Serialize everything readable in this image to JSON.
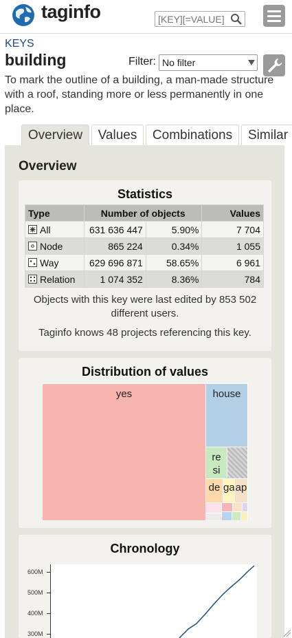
{
  "header": {
    "logo_text": "taginfo",
    "search_placeholder": "[KEY][=VALUE]",
    "icons": {
      "logo": "globe-icon",
      "search": "search-icon",
      "menu": "hamburger-menu-icon"
    }
  },
  "page": {
    "breadcrumb": "KEYS",
    "key": "building",
    "filter_label": "Filter:",
    "filter_value": "No filter",
    "description": "To mark the outline of a building, a man-made structure with a roof, standing more or less permanently in one place."
  },
  "tabs": [
    {
      "label": "Overview",
      "active": true
    },
    {
      "label": "Values",
      "active": false
    },
    {
      "label": "Combinations",
      "active": false
    },
    {
      "label": "Similar",
      "active": false
    }
  ],
  "overview": {
    "title": "Overview",
    "statistics": {
      "title": "Statistics",
      "columns": [
        "Type",
        "Number of objects",
        "Values"
      ],
      "rows": [
        {
          "type": "All",
          "count": "631 636 447",
          "percent": "5.90%",
          "values": "7 704"
        },
        {
          "type": "Node",
          "count": "865 224",
          "percent": "0.34%",
          "values": "1 055"
        },
        {
          "type": "Way",
          "count": "629 696 871",
          "percent": "58.65%",
          "values": "6 961"
        },
        {
          "type": "Relation",
          "count": "1 074 352",
          "percent": "8.36%",
          "values": "784"
        }
      ],
      "note_users": "Objects with this key were last edited by 853 502 different users.",
      "note_projects": "Taginfo knows 48 projects referencing this key."
    },
    "distribution": {
      "title": "Distribution of values",
      "cells": [
        {
          "label": "yes",
          "color": "#f8b4ae"
        },
        {
          "label": "house",
          "color": "#b3cfe6"
        },
        {
          "label": "resi",
          "color": "#c7e9c0"
        },
        {
          "label": "",
          "color": "#cccccc"
        },
        {
          "label": "de",
          "color": "#fdd8a8"
        },
        {
          "label": "ga",
          "color": "#fdf4c0"
        },
        {
          "label": "ap",
          "color": "#f4e1c8"
        }
      ]
    },
    "chronology": {
      "title": "Chronology",
      "y_ticks": [
        "600M",
        "500M",
        "400M",
        "300M"
      ]
    }
  },
  "colors": {
    "link": "#1a4a8a",
    "panel": "#e5e4dd",
    "card": "#f3f2ee",
    "button_gray": "#9a9a9a",
    "line": "#1f4e79"
  }
}
